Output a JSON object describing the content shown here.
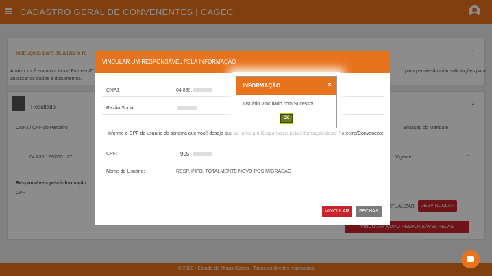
{
  "header": {
    "app_title": "CADASTRO GERAL DE CONVENENTES | CAGEC",
    "menu_icon": "hamburger-icon",
    "user_icon": "user-avatar-icon"
  },
  "background": {
    "instructions_title": "Instruções para atualizar o re",
    "instructions_text_left": "Abaixo você encontra todos Parceiro/C",
    "instructions_text_left2": "atualizar os dados e documentos.",
    "instructions_text_right": "para permissão criar solicitações para",
    "result_title": "Resultado",
    "col_cnpj": "CNPJ / CPF do Parceiro",
    "col_situacao": "Situação do Mandato",
    "row_cnpj": "04.830.129/0001-77",
    "row_situacao": "Vigente",
    "resp_title": "Responsáveis pela informação",
    "resp_col_cpf": "CPF",
    "btn_atualizar": "ATUALIZAR",
    "btn_desvincular": "DESVINCULAR",
    "btn_vincular_novo": "VINCULAR NOVO RESPONSÁVEL PELAS INFORMAÇÕES"
  },
  "footer": {
    "text": "© 2020 - Estado de Minas Gerais - Todos os direitos reservados"
  },
  "modal": {
    "title": "VINCULAR UM RESPONSÁVEL PELA INFORMAÇÃO",
    "cnpj_label": "CNPJ:",
    "cnpj_value": "04.830.",
    "razao_label": "Razão Social:",
    "instructions": "Informe o CPF do usuário do sistema que você deseja que se torne um Responsável pela Informação deste Parceiro/Convenente",
    "cpf_label": "CPF:",
    "cpf_value": "905.",
    "nome_label": "Nome do Usuário:",
    "nome_value": "RESP. INFO. TOTALMENTE NOVO POS MIGRACAO",
    "btn_vincular": "VINCULAR",
    "btn_fechar": "FECHAR"
  },
  "alert": {
    "title": "INFORMAÇÃO",
    "close": "×",
    "message": "Usuário Vinculado com Sucesso!",
    "ok": "OK"
  },
  "chat": {
    "icon": "chat-icon"
  }
}
